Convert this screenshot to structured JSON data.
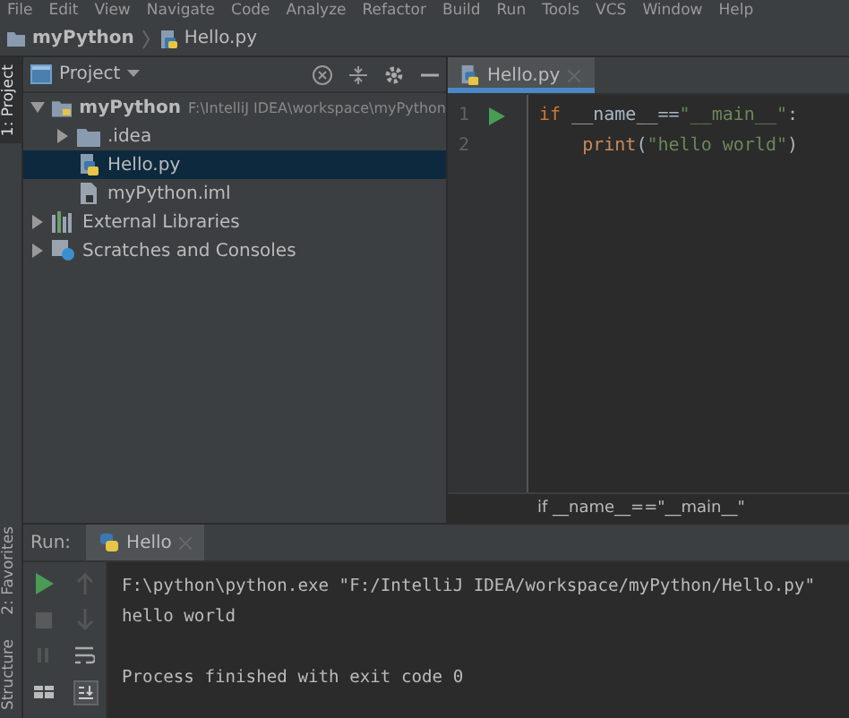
{
  "menu_bar": [
    "File",
    "Edit",
    "View",
    "Navigate",
    "Code",
    "Analyze",
    "Refactor",
    "Build",
    "Run",
    "Tools",
    "VCS",
    "Window",
    "Help"
  ],
  "breadcrumbs": [
    "myPython",
    "Hello.py"
  ],
  "side_strip": [
    {
      "label": "1: Project",
      "selected": true
    },
    {
      "label": "2: Favorites",
      "selected": false
    },
    {
      "label": "Structure",
      "selected": false
    }
  ],
  "project_panel": {
    "title": "Project",
    "tree": [
      {
        "name": "myPython",
        "kind": "module",
        "path": "F:\\IntelliJ IDEA\\workspace\\myPython",
        "expanded": true,
        "selected": false,
        "children": [
          {
            "name": ".idea",
            "kind": "folder",
            "expanded": false,
            "selected": false
          },
          {
            "name": "Hello.py",
            "kind": "python",
            "selected": true
          },
          {
            "name": "myPython.iml",
            "kind": "iml",
            "selected": false
          }
        ]
      },
      {
        "name": "External Libraries",
        "kind": "libraries",
        "expanded": false,
        "selected": false
      },
      {
        "name": "Scratches and Consoles",
        "kind": "scratches",
        "expanded": false,
        "selected": false
      }
    ]
  },
  "editor": {
    "tabs": [
      {
        "label": "Hello.py",
        "selected": true
      }
    ],
    "lines": [
      {
        "number": "1",
        "runnable": true,
        "tokens": [
          {
            "text": "if",
            "kind": "keyword"
          },
          {
            "text": " __name__==",
            "kind": "plain"
          },
          {
            "text": "\"__main__\"",
            "kind": "string"
          },
          {
            "text": ":",
            "kind": "plain"
          }
        ]
      },
      {
        "number": "2",
        "runnable": false,
        "tokens": [
          {
            "text": "    print",
            "kind": "builtin"
          },
          {
            "text": "(",
            "kind": "plain"
          },
          {
            "text": "\"hello world\"",
            "kind": "string"
          },
          {
            "text": ")",
            "kind": "plain"
          }
        ]
      }
    ],
    "breadcrumb": "if __name__==\"__main__\""
  },
  "run_panel": {
    "label": "Run:",
    "tabs": [
      {
        "label": "Hello",
        "selected": true
      }
    ],
    "output": [
      {
        "text": "F:\\python\\python.exe \"F:/IntelliJ IDEA/workspace/myPython/Hello.py\""
      },
      {
        "text": "hello world"
      },
      {
        "text": "Process finished with exit code 0",
        "gap_before": true
      }
    ]
  }
}
